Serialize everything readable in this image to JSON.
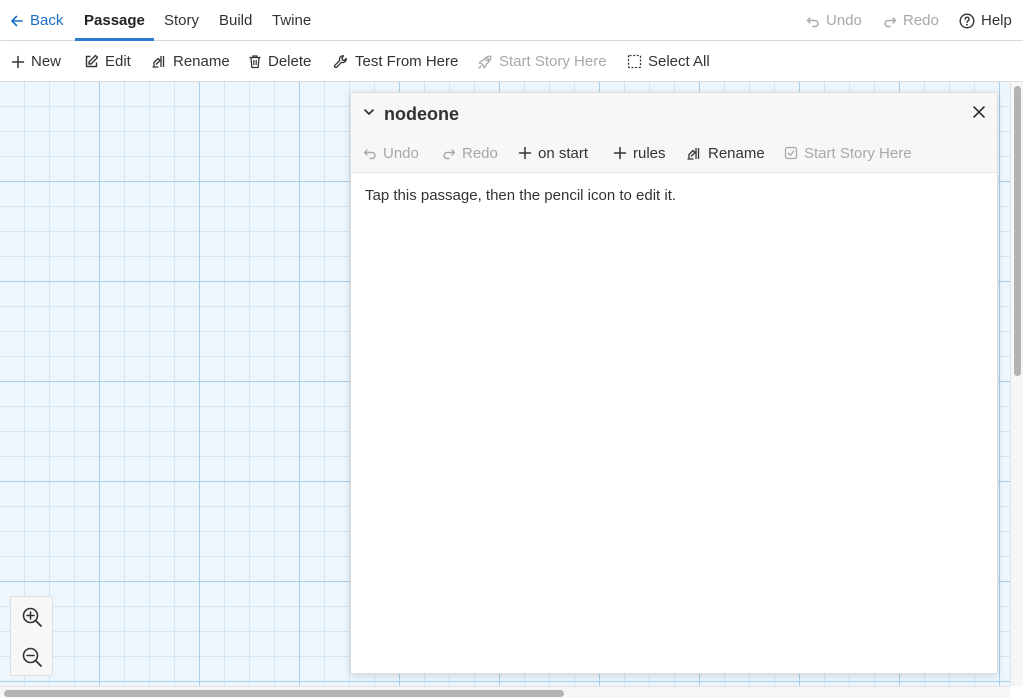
{
  "topbar": {
    "back": "Back",
    "tabs": [
      "Passage",
      "Story",
      "Build",
      "Twine"
    ],
    "undo": "Undo",
    "redo": "Redo",
    "help": "Help"
  },
  "toolbar": {
    "new": "New",
    "edit": "Edit",
    "rename": "Rename",
    "delete": "Delete",
    "test_from_here": "Test From Here",
    "start_story_here": "Start Story Here",
    "select_all": "Select All"
  },
  "dialog": {
    "title": "nodeone",
    "undo": "Undo",
    "redo": "Redo",
    "on_start": "on start",
    "rules": "rules",
    "rename": "Rename",
    "start_story_here": "Start Story Here",
    "body": "Tap this passage, then the pencil icon to edit it."
  },
  "colors": {
    "accent": "#2f7dd1",
    "grid_background": "#edf5fd",
    "disabled_text": "#a8a8a8"
  },
  "icons": [
    "arrow-left-icon",
    "undo-icon",
    "redo-icon",
    "help-circle-icon",
    "plus-icon",
    "pencil-square-icon",
    "rename-icon",
    "trash-icon",
    "wrench-icon",
    "rocket-icon",
    "dashed-square-icon",
    "chevron-down-icon",
    "close-icon",
    "checkbox-icon",
    "zoom-in-icon",
    "zoom-out-icon"
  ]
}
